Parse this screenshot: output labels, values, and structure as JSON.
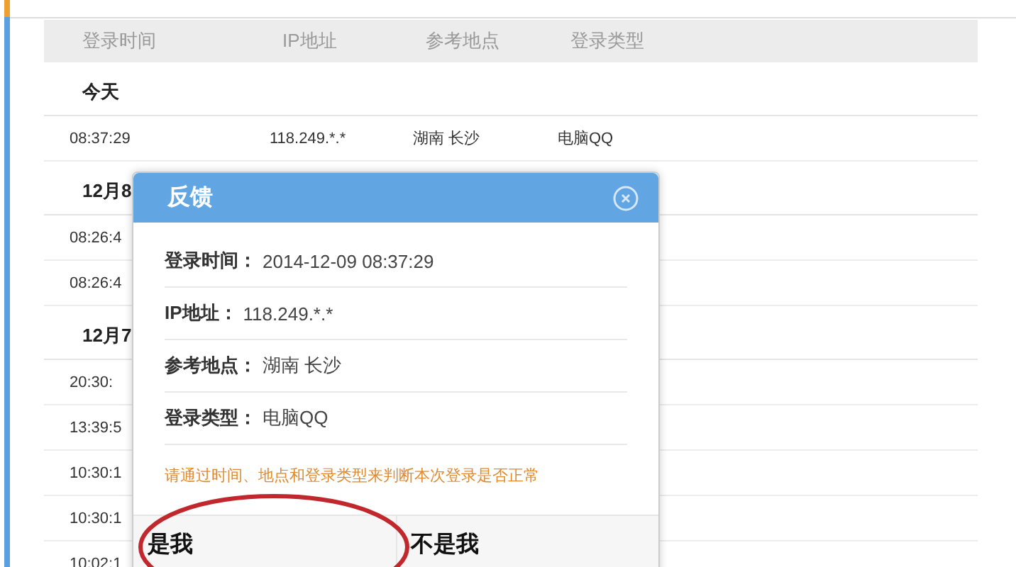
{
  "table": {
    "columns": [
      "登录时间",
      "IP地址",
      "参考地点",
      "登录类型"
    ],
    "groups": [
      {
        "label": "今天",
        "rows": [
          [
            "08:37:29",
            "118.249.*.*",
            "湖南 长沙",
            "电脑QQ"
          ]
        ]
      },
      {
        "label": "12月8",
        "rows": [
          [
            "08:26:4"
          ],
          [
            "08:26:4"
          ]
        ]
      },
      {
        "label": "12月7",
        "rows": [
          [
            "20:30:"
          ],
          [
            "13:39:5"
          ],
          [
            "10:30:1"
          ],
          [
            "10:30:1"
          ],
          [
            "10:02:1"
          ]
        ]
      }
    ]
  },
  "dialog": {
    "title": "反馈",
    "fields": [
      {
        "label": "登录时间：",
        "value": "2014-12-09 08:37:29"
      },
      {
        "label": "IP地址：",
        "value": "118.249.*.*"
      },
      {
        "label": "参考地点：",
        "value": "湖南 长沙"
      },
      {
        "label": "登录类型：",
        "value": "电脑QQ"
      }
    ],
    "note": "请通过时间、地点和登录类型来判断本次登录是否正常",
    "buttons": [
      "是我",
      "不是我"
    ]
  }
}
